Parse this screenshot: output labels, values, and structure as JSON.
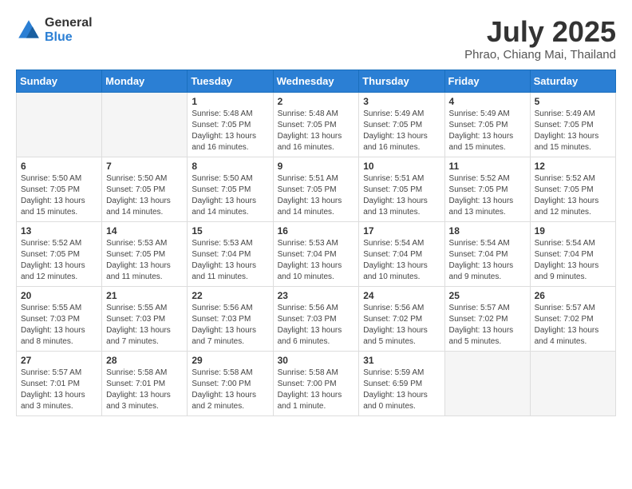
{
  "logo": {
    "line1": "General",
    "line2": "Blue"
  },
  "title": "July 2025",
  "location": "Phrao, Chiang Mai, Thailand",
  "headers": [
    "Sunday",
    "Monday",
    "Tuesday",
    "Wednesday",
    "Thursday",
    "Friday",
    "Saturday"
  ],
  "weeks": [
    [
      {
        "day": "",
        "info": ""
      },
      {
        "day": "",
        "info": ""
      },
      {
        "day": "1",
        "info": "Sunrise: 5:48 AM\nSunset: 7:05 PM\nDaylight: 13 hours\nand 16 minutes."
      },
      {
        "day": "2",
        "info": "Sunrise: 5:48 AM\nSunset: 7:05 PM\nDaylight: 13 hours\nand 16 minutes."
      },
      {
        "day": "3",
        "info": "Sunrise: 5:49 AM\nSunset: 7:05 PM\nDaylight: 13 hours\nand 16 minutes."
      },
      {
        "day": "4",
        "info": "Sunrise: 5:49 AM\nSunset: 7:05 PM\nDaylight: 13 hours\nand 15 minutes."
      },
      {
        "day": "5",
        "info": "Sunrise: 5:49 AM\nSunset: 7:05 PM\nDaylight: 13 hours\nand 15 minutes."
      }
    ],
    [
      {
        "day": "6",
        "info": "Sunrise: 5:50 AM\nSunset: 7:05 PM\nDaylight: 13 hours\nand 15 minutes."
      },
      {
        "day": "7",
        "info": "Sunrise: 5:50 AM\nSunset: 7:05 PM\nDaylight: 13 hours\nand 14 minutes."
      },
      {
        "day": "8",
        "info": "Sunrise: 5:50 AM\nSunset: 7:05 PM\nDaylight: 13 hours\nand 14 minutes."
      },
      {
        "day": "9",
        "info": "Sunrise: 5:51 AM\nSunset: 7:05 PM\nDaylight: 13 hours\nand 14 minutes."
      },
      {
        "day": "10",
        "info": "Sunrise: 5:51 AM\nSunset: 7:05 PM\nDaylight: 13 hours\nand 13 minutes."
      },
      {
        "day": "11",
        "info": "Sunrise: 5:52 AM\nSunset: 7:05 PM\nDaylight: 13 hours\nand 13 minutes."
      },
      {
        "day": "12",
        "info": "Sunrise: 5:52 AM\nSunset: 7:05 PM\nDaylight: 13 hours\nand 12 minutes."
      }
    ],
    [
      {
        "day": "13",
        "info": "Sunrise: 5:52 AM\nSunset: 7:05 PM\nDaylight: 13 hours\nand 12 minutes."
      },
      {
        "day": "14",
        "info": "Sunrise: 5:53 AM\nSunset: 7:05 PM\nDaylight: 13 hours\nand 11 minutes."
      },
      {
        "day": "15",
        "info": "Sunrise: 5:53 AM\nSunset: 7:04 PM\nDaylight: 13 hours\nand 11 minutes."
      },
      {
        "day": "16",
        "info": "Sunrise: 5:53 AM\nSunset: 7:04 PM\nDaylight: 13 hours\nand 10 minutes."
      },
      {
        "day": "17",
        "info": "Sunrise: 5:54 AM\nSunset: 7:04 PM\nDaylight: 13 hours\nand 10 minutes."
      },
      {
        "day": "18",
        "info": "Sunrise: 5:54 AM\nSunset: 7:04 PM\nDaylight: 13 hours\nand 9 minutes."
      },
      {
        "day": "19",
        "info": "Sunrise: 5:54 AM\nSunset: 7:04 PM\nDaylight: 13 hours\nand 9 minutes."
      }
    ],
    [
      {
        "day": "20",
        "info": "Sunrise: 5:55 AM\nSunset: 7:03 PM\nDaylight: 13 hours\nand 8 minutes."
      },
      {
        "day": "21",
        "info": "Sunrise: 5:55 AM\nSunset: 7:03 PM\nDaylight: 13 hours\nand 7 minutes."
      },
      {
        "day": "22",
        "info": "Sunrise: 5:56 AM\nSunset: 7:03 PM\nDaylight: 13 hours\nand 7 minutes."
      },
      {
        "day": "23",
        "info": "Sunrise: 5:56 AM\nSunset: 7:03 PM\nDaylight: 13 hours\nand 6 minutes."
      },
      {
        "day": "24",
        "info": "Sunrise: 5:56 AM\nSunset: 7:02 PM\nDaylight: 13 hours\nand 5 minutes."
      },
      {
        "day": "25",
        "info": "Sunrise: 5:57 AM\nSunset: 7:02 PM\nDaylight: 13 hours\nand 5 minutes."
      },
      {
        "day": "26",
        "info": "Sunrise: 5:57 AM\nSunset: 7:02 PM\nDaylight: 13 hours\nand 4 minutes."
      }
    ],
    [
      {
        "day": "27",
        "info": "Sunrise: 5:57 AM\nSunset: 7:01 PM\nDaylight: 13 hours\nand 3 minutes."
      },
      {
        "day": "28",
        "info": "Sunrise: 5:58 AM\nSunset: 7:01 PM\nDaylight: 13 hours\nand 3 minutes."
      },
      {
        "day": "29",
        "info": "Sunrise: 5:58 AM\nSunset: 7:00 PM\nDaylight: 13 hours\nand 2 minutes."
      },
      {
        "day": "30",
        "info": "Sunrise: 5:58 AM\nSunset: 7:00 PM\nDaylight: 13 hours\nand 1 minute."
      },
      {
        "day": "31",
        "info": "Sunrise: 5:59 AM\nSunset: 6:59 PM\nDaylight: 13 hours\nand 0 minutes."
      },
      {
        "day": "",
        "info": ""
      },
      {
        "day": "",
        "info": ""
      }
    ]
  ]
}
